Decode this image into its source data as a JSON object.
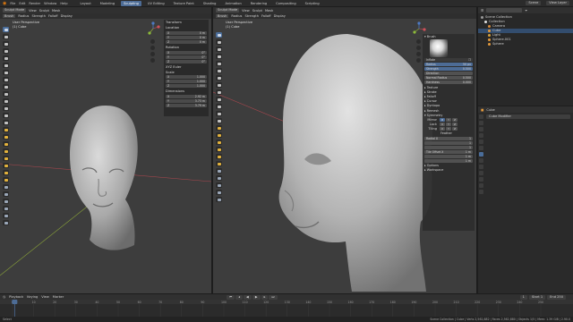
{
  "topbar": {
    "menus": [
      "File",
      "Edit",
      "Render",
      "Window",
      "Help"
    ],
    "workspaces": [
      "Layout",
      "Modeling",
      "Sculpting",
      "UV Editing",
      "Texture Paint",
      "Shading",
      "Animation",
      "Rendering",
      "Compositing",
      "Scripting"
    ],
    "active_workspace": "Sculpting",
    "scene": "Scene",
    "view_layer": "View Layer"
  },
  "viewport_left": {
    "mode": "Sculpt Mode",
    "menus": [
      "View",
      "Sculpt",
      "Mask"
    ],
    "perspective_label": "User Perspective",
    "object_label": "(1) Cube",
    "tool_header": [
      "Brush",
      "Radius",
      "Strength",
      "Falloff",
      "Display"
    ],
    "npanel": {
      "title": "Transform",
      "sections": [
        {
          "label": "Location",
          "rows": [
            [
              "X",
              "0 m"
            ],
            [
              "Y",
              "0 m"
            ],
            [
              "Z",
              "0 m"
            ]
          ]
        },
        {
          "label": "Rotation",
          "rows": [
            [
              "X",
              "0°"
            ],
            [
              "Y",
              "0°"
            ],
            [
              "Z",
              "0°"
            ]
          ]
        },
        {
          "label": "XYZ Euler",
          "rows": []
        },
        {
          "label": "Scale",
          "rows": [
            [
              "X",
              "1.000"
            ],
            [
              "Y",
              "1.000"
            ],
            [
              "Z",
              "1.000"
            ]
          ]
        },
        {
          "label": "Dimensions",
          "rows": [
            [
              "X",
              "2.92 m"
            ],
            [
              "Y",
              "3.73 m"
            ],
            [
              "Z",
              "3.79 m"
            ]
          ]
        }
      ]
    }
  },
  "viewport_right": {
    "mode": "Sculpt Mode",
    "menus": [
      "View",
      "Sculpt",
      "Mask"
    ],
    "perspective_label": "User Perspective",
    "object_label": "(1) Cube",
    "tool_header": [
      "Brush",
      "Radius",
      "Strength",
      "Falloff",
      "Display"
    ],
    "brush_panel": {
      "title": "Brush",
      "brush_name": "Inflate",
      "rows": [
        {
          "label": "Radius",
          "value": "50 px",
          "accent": true
        },
        {
          "label": "Strength",
          "value": "0.500",
          "accent": true
        },
        {
          "label": "Direction",
          "value": "",
          "accent": false
        },
        {
          "label": "Normal Radius",
          "value": "0.500",
          "accent": false
        },
        {
          "label": "Hardness",
          "value": "0.000",
          "accent": false
        }
      ],
      "sections": [
        "Texture",
        "Stroke",
        "Falloff",
        "Cursor",
        "Dyntopo",
        "Remesh",
        "Symmetry"
      ],
      "symmetry": {
        "rows": [
          [
            "Mirror",
            "X",
            "Y",
            "Z"
          ],
          [
            "Lock",
            "X",
            "Y",
            "Z"
          ],
          [
            "Tiling",
            "X",
            "Y",
            "Z"
          ]
        ],
        "feather_label": "Feather",
        "radial_label": "Radial X",
        "radial_values": [
          "1",
          "1",
          "1"
        ],
        "tile_offset_label": "Tile Offset X",
        "tile_values": [
          "1 m",
          "1 m",
          "1 m"
        ]
      },
      "footer_sections": [
        "Options",
        "Workspace"
      ]
    }
  },
  "outliner": {
    "header": "Scene Collection",
    "rows": [
      {
        "label": "Scene Collection",
        "indent": 0,
        "selected": false,
        "color": "#9a9a9a"
      },
      {
        "label": "Collection",
        "indent": 1,
        "selected": false,
        "color": "#e0e0e0"
      },
      {
        "label": "Camera",
        "indent": 2,
        "selected": false,
        "color": "#d88a3a"
      },
      {
        "label": "Cube",
        "indent": 2,
        "selected": true,
        "color": "#e49a3c"
      },
      {
        "label": "Light",
        "indent": 2,
        "selected": false,
        "color": "#d8a03a"
      },
      {
        "label": "Sphere.001",
        "indent": 2,
        "selected": false,
        "color": "#e49a3c"
      },
      {
        "label": "Sphere",
        "indent": 2,
        "selected": false,
        "color": "#e49a3c"
      }
    ]
  },
  "properties": {
    "object_name": "Cube",
    "field": "Cube Modifier"
  },
  "timeline": {
    "menus": [
      "Playback",
      "Keying",
      "View",
      "Marker"
    ],
    "frame_ticks": [
      "0",
      "10",
      "20",
      "30",
      "40",
      "50",
      "60",
      "70",
      "80",
      "90",
      "100",
      "110",
      "120",
      "130",
      "140",
      "150",
      "160",
      "170",
      "180",
      "190",
      "200",
      "210",
      "220",
      "230",
      "240",
      "250"
    ],
    "current_frame": "1",
    "start_label": "Start",
    "start": "1",
    "end_label": "End",
    "end": "250"
  },
  "statusbar": {
    "left": "Select",
    "right": "Scene Collection | Cube | Verts 2,562,882 | Faces 2,562,880 | Objects 1/5 | Mem: 1.39 GiB | 2.90.0"
  },
  "colors": {
    "accent": "#4d6c96",
    "viewport_bg": "#3d3d3d",
    "x_axis": "#a8474e",
    "y_axis": "#8aa33a"
  }
}
